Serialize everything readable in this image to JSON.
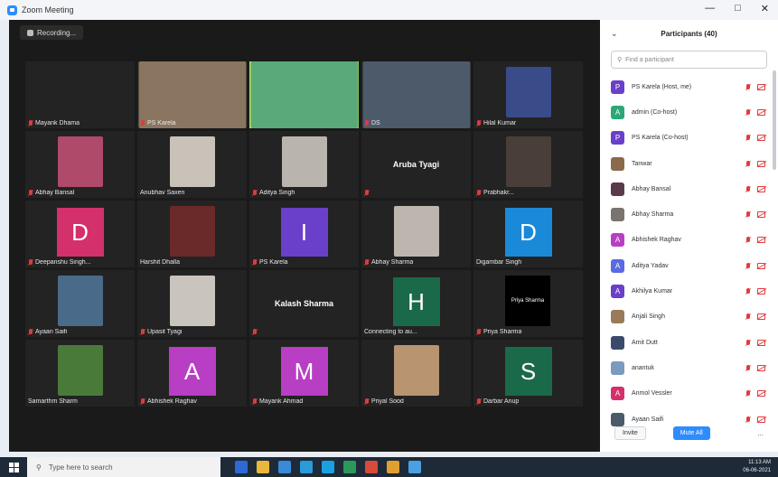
{
  "window": {
    "title": "Zoom Meeting",
    "controls": [
      "—",
      "□",
      "✕"
    ]
  },
  "meeting": {
    "recording_label": "Recording...",
    "tiles": [
      {
        "name": "Mayank Dhama",
        "kind": "black",
        "muted": true
      },
      {
        "name": "PS Karela",
        "kind": "video",
        "color": "#8a7560",
        "muted": true
      },
      {
        "name": "",
        "kind": "video",
        "color": "#5aa97a",
        "muted": false,
        "active": true
      },
      {
        "name": "DS",
        "kind": "video",
        "color": "#4c5a6a",
        "muted": true
      },
      {
        "name": "Hilal Kumar",
        "kind": "photo",
        "color": "#3a4b8a",
        "muted": true
      },
      {
        "name": "Abhay Bansal",
        "kind": "photo",
        "color": "#b04a6a",
        "muted": true
      },
      {
        "name": "Anubhav Saxen",
        "kind": "photo",
        "color": "#c9c2b8",
        "muted": false
      },
      {
        "name": "Aditya Singh",
        "kind": "photo",
        "color": "#b9b4ad",
        "muted": true
      },
      {
        "name": "",
        "kind": "center",
        "label": "Aruba Tyagi",
        "muted": true
      },
      {
        "name": "Prabhakr...",
        "kind": "photo",
        "color": "#4a3e3a",
        "muted": true
      },
      {
        "name": "Deepanshu Singh...",
        "kind": "avatar",
        "letter": "D",
        "color": "#d4306b",
        "muted": true
      },
      {
        "name": "Harshit Dhalla",
        "kind": "photo",
        "color": "#6a2a2a",
        "muted": false
      },
      {
        "name": "PS Karela",
        "kind": "avatar",
        "letter": "I",
        "color": "#6a3fc9",
        "muted": true
      },
      {
        "name": "Abhay Sharma",
        "kind": "photo",
        "color": "#bdb6ae",
        "muted": true
      },
      {
        "name": "Digambar Singh",
        "kind": "avatar",
        "letter": "D",
        "color": "#1a8ad8",
        "muted": false
      },
      {
        "name": "Ayaan Saifi",
        "kind": "photo",
        "color": "#4a6a8a",
        "muted": true
      },
      {
        "name": "Upasit Tyagi",
        "kind": "photo",
        "color": "#c9c4bd",
        "muted": true
      },
      {
        "name": "",
        "kind": "center",
        "label": "Kalash Sharma",
        "muted": true
      },
      {
        "name": "Connecting to au...",
        "kind": "avatar",
        "letter": "H",
        "color": "#1a6a4a",
        "muted": false
      },
      {
        "name": "Priya Sharma",
        "kind": "center-small",
        "label": "Priya Sharma",
        "muted": true
      },
      {
        "name": "Samarthm Sharm",
        "kind": "photo",
        "color": "#4a7a3a",
        "muted": false
      },
      {
        "name": "Abhishek Raghav",
        "kind": "avatar",
        "letter": "A",
        "color": "#b83ec4",
        "muted": true
      },
      {
        "name": "Mayank Ahmad",
        "kind": "avatar",
        "letter": "M",
        "color": "#b83ec4",
        "muted": true
      },
      {
        "name": "Priyal Sood",
        "kind": "photo",
        "color": "#b89470",
        "muted": true
      },
      {
        "name": "Darbar Anup",
        "kind": "avatar",
        "letter": "S",
        "color": "#1a6a4a",
        "muted": true
      }
    ]
  },
  "participants": {
    "title": "Participants (40)",
    "search_placeholder": "Find a participant",
    "list": [
      {
        "name": "PS Karela (Host, me)",
        "letter": "P",
        "color": "#6a3fc9"
      },
      {
        "name": "admin (Co-host)",
        "letter": "A",
        "color": "#2aa876"
      },
      {
        "name": "PS Karela (Co-host)",
        "letter": "P",
        "color": "#6a3fc9"
      },
      {
        "name": "Tanwar",
        "letter": "",
        "color": "#8a6a4a"
      },
      {
        "name": "Abhay Bansal",
        "letter": "",
        "color": "#5a3a4a"
      },
      {
        "name": "Abhay Sharma",
        "letter": "",
        "color": "#7a7470"
      },
      {
        "name": "Abhishek Raghav",
        "letter": "A",
        "color": "#b83ec4"
      },
      {
        "name": "Aditya Yadav",
        "letter": "A",
        "color": "#5a6ae0"
      },
      {
        "name": "Akhilya Kumar",
        "letter": "A",
        "color": "#6a3fc9"
      },
      {
        "name": "Anjali Singh",
        "letter": "",
        "color": "#9a7a5a"
      },
      {
        "name": "Amit Dutt",
        "letter": "",
        "color": "#3a4a6a"
      },
      {
        "name": "anantuk",
        "letter": "",
        "color": "#7a9ac0"
      },
      {
        "name": "Anmol Vessler",
        "letter": "A",
        "color": "#d4306b"
      },
      {
        "name": "Ayaan Saifi",
        "letter": "",
        "color": "#4a5a6a"
      }
    ],
    "invite_label": "Invite",
    "mute_all_label": "Mute All",
    "more_label": "..."
  },
  "taskbar": {
    "search_placeholder": "Type here to search",
    "time": "11:13 AM",
    "date": "06-06-2021",
    "apps": [
      "#2d6ad8",
      "#e8b83a",
      "#3a8ad8",
      "#2a9ad8",
      "#1aa0e0",
      "#2a9a5a",
      "#d84a3a",
      "#e0a030",
      "#4aa0e0"
    ]
  }
}
